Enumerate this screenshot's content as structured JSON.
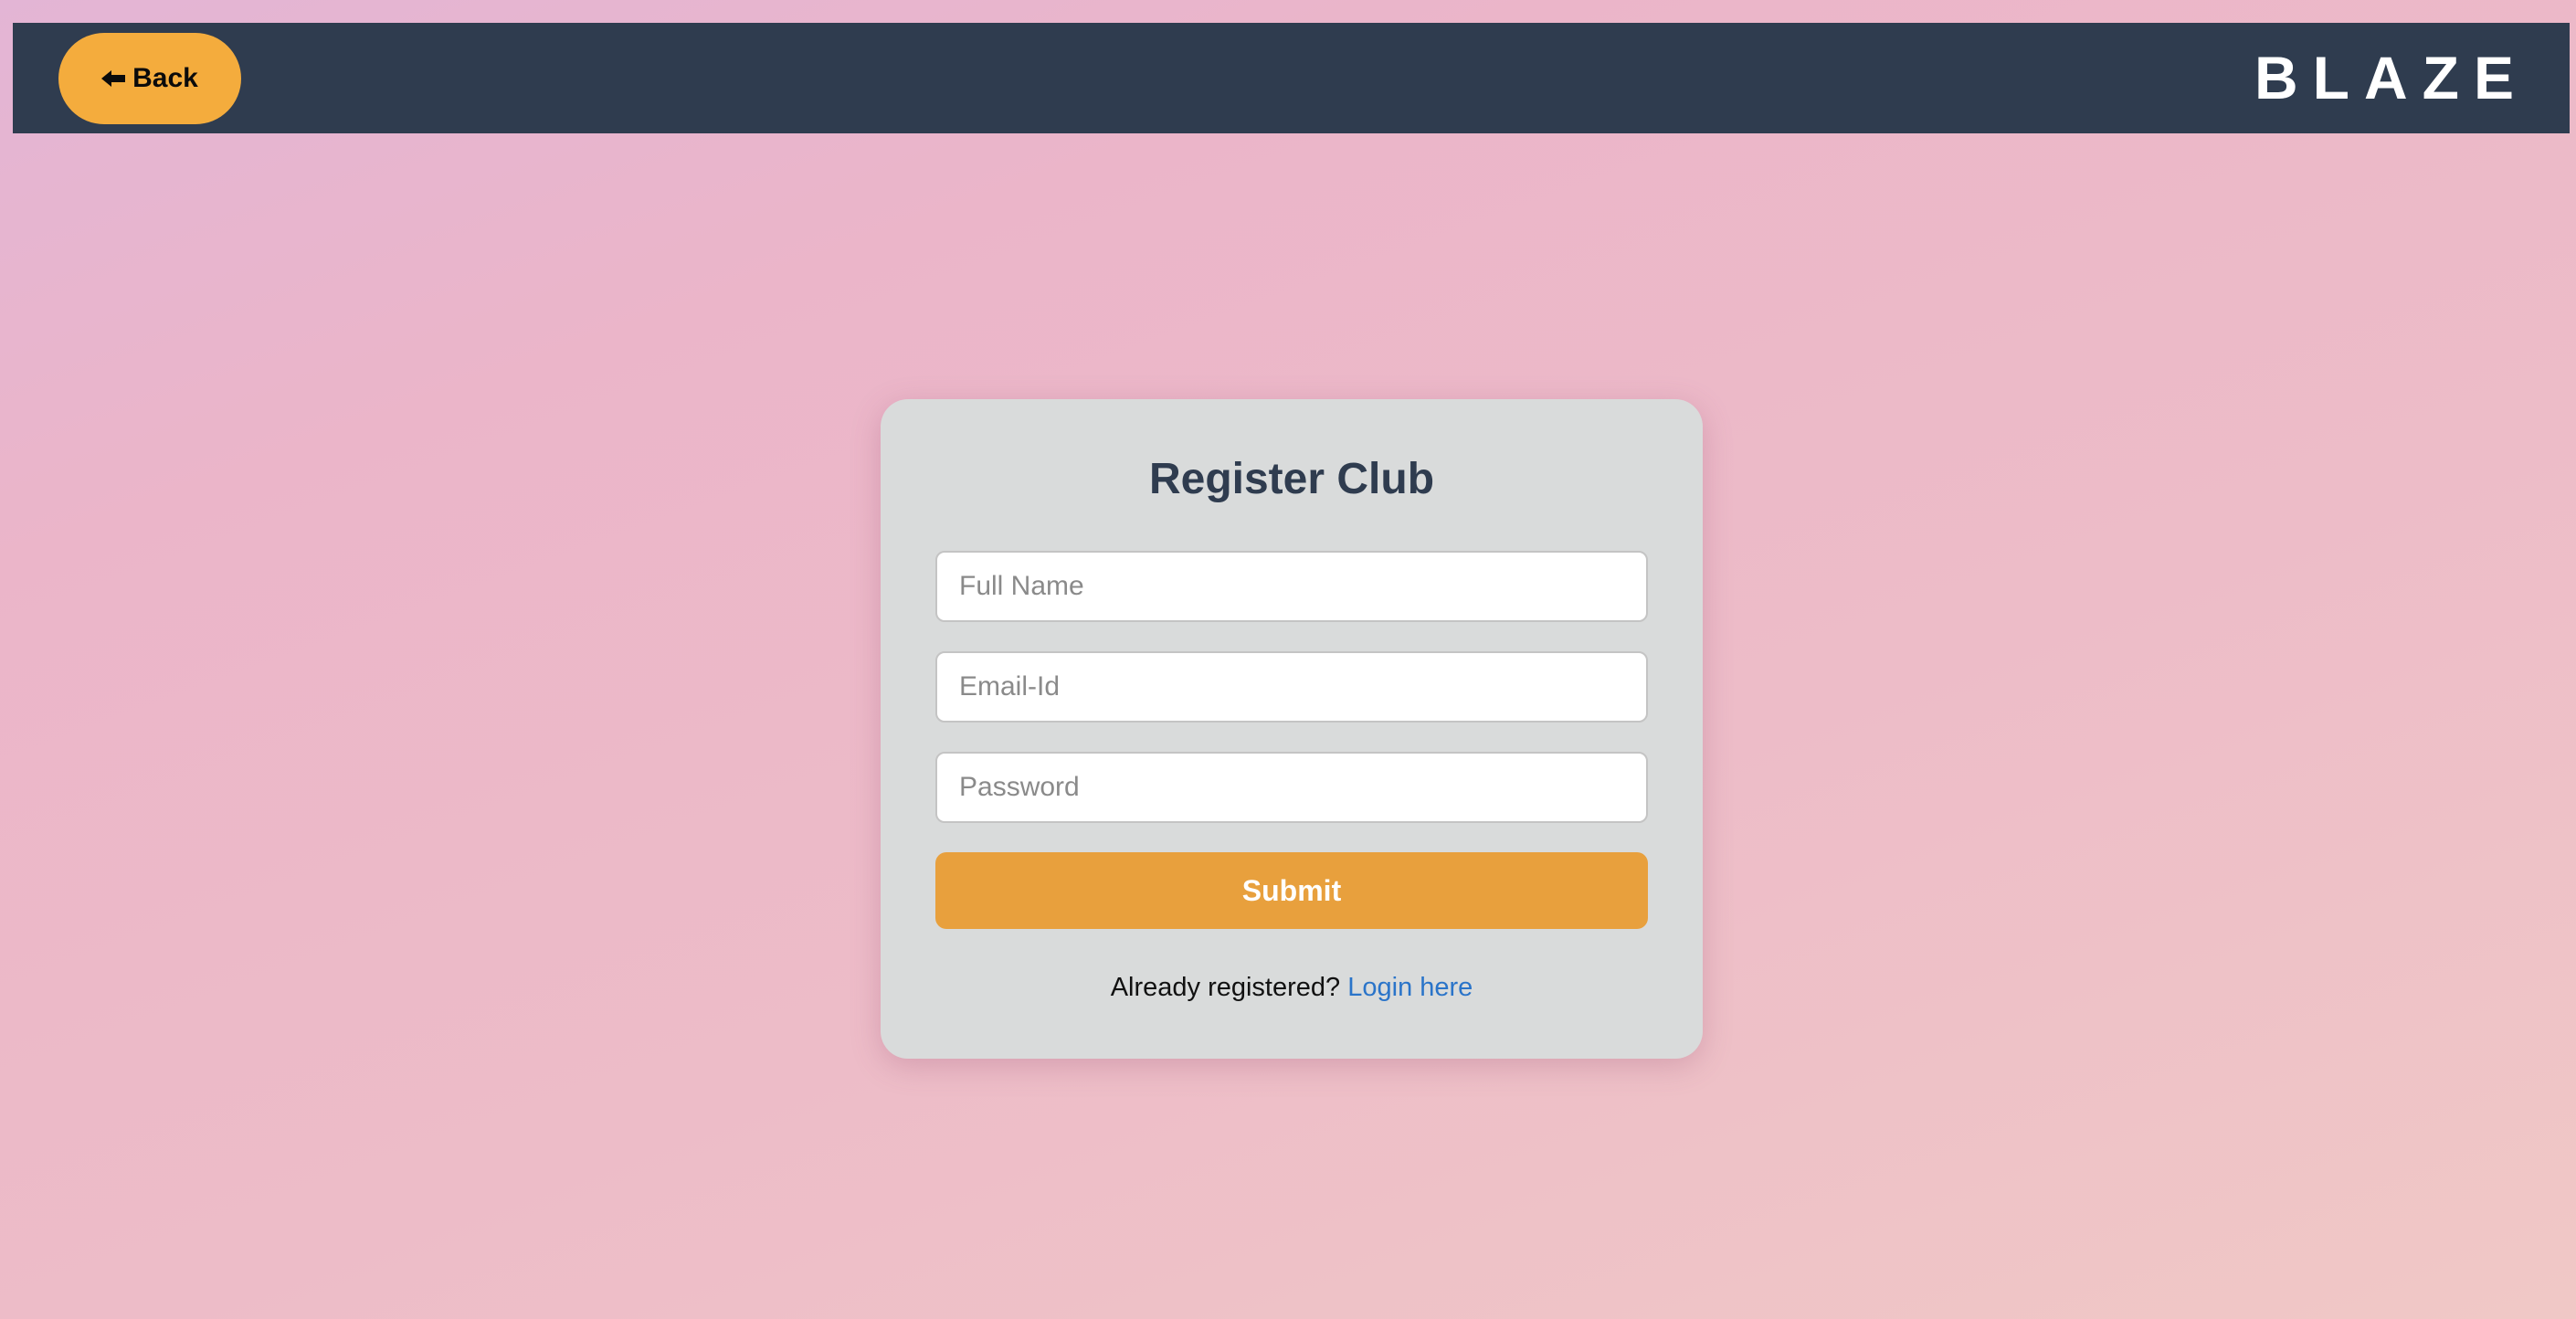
{
  "navbar": {
    "back_label": "Back",
    "back_icon": "arrow-left-icon",
    "brand": "BLAZE"
  },
  "form": {
    "title": "Register Club",
    "full_name": {
      "value": "",
      "placeholder": "Full Name"
    },
    "email": {
      "value": "",
      "placeholder": "Email-Id"
    },
    "password": {
      "value": "",
      "placeholder": "Password"
    },
    "submit_label": "Submit",
    "footer_text": "Already registered?",
    "login_link": "Login here"
  },
  "colors": {
    "navbar_bg": "#2f3c4f",
    "accent": "#f4ac3d",
    "submit_bg": "#e8a03d",
    "card_bg": "#d9dbdb",
    "link": "#2a74c9"
  }
}
